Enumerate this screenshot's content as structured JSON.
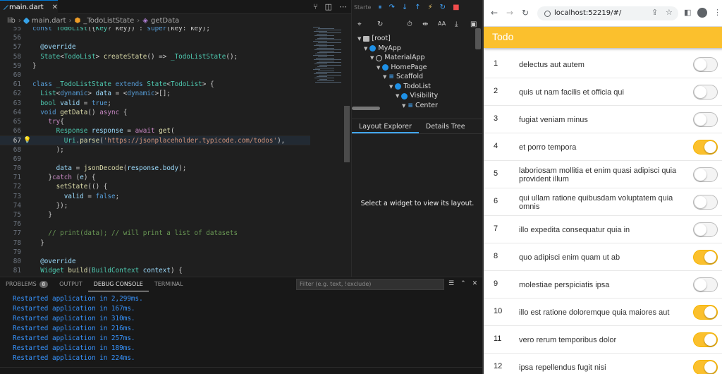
{
  "editor": {
    "tab_label": "main.dart",
    "breadcrumb": [
      "lib",
      "main.dart",
      "_TodoListState",
      "getData"
    ],
    "current_line": "66",
    "lines": [
      {
        "n": "55",
        "html": "<span class=\"kw\">const</span> <span class=\"ty\">TodoList</span>({<span class=\"ty\">Key</span>? key}) : <span class=\"kw\">super</span>(key: key);"
      },
      {
        "n": "56",
        "html": ""
      },
      {
        "n": "57",
        "html": "  <span class=\"an\">@override</span>"
      },
      {
        "n": "58",
        "html": "  <span class=\"ty\">State</span>&lt;<span class=\"ty\">TodoList</span>&gt; <span class=\"fn\">createState</span>() =&gt; <span class=\"ty\">_TodoListState</span>();"
      },
      {
        "n": "59",
        "html": "}"
      },
      {
        "n": "60",
        "html": ""
      },
      {
        "n": "61",
        "html": "<span class=\"kw\">class</span> <span class=\"ty\">_TodoListState</span> <span class=\"kw\">extends</span> <span class=\"ty\">State</span>&lt;<span class=\"ty\">TodoList</span>&gt; {"
      },
      {
        "n": "62",
        "html": "  <span class=\"ty\">List</span>&lt;<span class=\"kw\">dynamic</span>&gt; <span class=\"an\">data</span> = &lt;<span class=\"kw\">dynamic</span>&gt;[];"
      },
      {
        "n": "63",
        "html": "  <span class=\"ty\">bool</span> <span class=\"an\">valid</span> = <span class=\"kw\">true</span>;"
      },
      {
        "n": "64",
        "html": "  <span class=\"kw\">void</span> <span class=\"fn\">getData</span>() <span class=\"ctl\">async</span> {"
      },
      {
        "n": "65",
        "html": "    <span class=\"ctl\">try</span>{"
      },
      {
        "n": "66",
        "html": "      <span class=\"ty\">Response</span> <span class=\"an\">response</span> = <span class=\"ctl\">await</span> <span class=\"fn\">get</span>("
      },
      {
        "n": "66",
        "html": "        <span class=\"ty\">Uri</span>.<span class=\"fn\">parse</span>(<span class=\"str\">'https://jsonplaceholder.typicode.com/todos'</span>),"
      },
      {
        "n": "67",
        "html": "      );"
      },
      {
        "n": "68",
        "html": ""
      },
      {
        "n": "69",
        "html": "      <span class=\"an\">data</span> = <span class=\"fn\">jsonDecode</span>(<span class=\"an\">response</span>.<span class=\"an\">body</span>);"
      },
      {
        "n": "70",
        "html": "    }<span class=\"ctl\">catch</span> (<span class=\"an\">e</span>) {"
      },
      {
        "n": "71",
        "html": "      <span class=\"fn\">setState</span>(() {"
      },
      {
        "n": "72",
        "html": "        <span class=\"an\">valid</span> = <span class=\"kw\">false</span>;"
      },
      {
        "n": "73",
        "html": "      });"
      },
      {
        "n": "74",
        "html": "    }"
      },
      {
        "n": "75",
        "html": ""
      },
      {
        "n": "76",
        "html": "    <span class=\"cm\">// print(data); // will print a list of datasets</span>"
      },
      {
        "n": "77",
        "html": "  }"
      },
      {
        "n": "78",
        "html": ""
      },
      {
        "n": "79",
        "html": "  <span class=\"an\">@override</span>"
      },
      {
        "n": "80",
        "html": "  <span class=\"ty\">Widget</span> <span class=\"fn\">build</span>(<span class=\"ty\">BuildContext</span> <span class=\"an\">context</span>) {"
      }
    ]
  },
  "panel": {
    "tabs": [
      {
        "label": "PROBLEMS",
        "badge": "8"
      },
      {
        "label": "OUTPUT",
        "badge": ""
      },
      {
        "label": "DEBUG CONSOLE",
        "badge": ""
      },
      {
        "label": "TERMINAL",
        "badge": ""
      }
    ],
    "active_tab": "DEBUG CONSOLE",
    "filter_placeholder": "Filter (e.g. text, !exclude)",
    "console_lines": [
      "Restarted application in 2,299ms.",
      "Restarted application in 167ms.",
      "Restarted application in 310ms.",
      "Restarted application in 216ms.",
      "Restarted application in 257ms.",
      "Restarted application in 189ms.",
      "Restarted application in 224ms."
    ]
  },
  "devtools": {
    "top_label": "Starte",
    "tree": [
      {
        "label": "[root]",
        "depth": 0,
        "icon": "square"
      },
      {
        "label": "MyApp",
        "depth": 1,
        "icon": "dot"
      },
      {
        "label": "MaterialApp",
        "depth": 2,
        "icon": "material"
      },
      {
        "label": "HomePage",
        "depth": 3,
        "icon": "dot"
      },
      {
        "label": "Scaffold",
        "depth": 4,
        "icon": "bars"
      },
      {
        "label": "TodoList",
        "depth": 5,
        "icon": "dot"
      },
      {
        "label": "Visibility",
        "depth": 6,
        "icon": "dot"
      },
      {
        "label": "Center",
        "depth": 7,
        "icon": "bars"
      }
    ],
    "tabs": [
      "Layout Explorer",
      "Details Tree"
    ],
    "active_tab": "Layout Explorer",
    "empty_message": "Select a widget to view its layout."
  },
  "browser": {
    "url": "localhost:52219/#/",
    "app_title": "Todo",
    "accent": "#fbc02d",
    "todos": [
      {
        "id": "1",
        "title": "delectus aut autem",
        "completed": false
      },
      {
        "id": "2",
        "title": "quis ut nam facilis et officia qui",
        "completed": false
      },
      {
        "id": "3",
        "title": "fugiat veniam minus",
        "completed": false
      },
      {
        "id": "4",
        "title": "et porro tempora",
        "completed": true
      },
      {
        "id": "5",
        "title": "laboriosam mollitia et enim quasi adipisci quia provident illum",
        "completed": false
      },
      {
        "id": "6",
        "title": "qui ullam ratione quibusdam voluptatem quia omnis",
        "completed": false
      },
      {
        "id": "7",
        "title": "illo expedita consequatur quia in",
        "completed": false
      },
      {
        "id": "8",
        "title": "quo adipisci enim quam ut ab",
        "completed": true
      },
      {
        "id": "9",
        "title": "molestiae perspiciatis ipsa",
        "completed": false
      },
      {
        "id": "10",
        "title": "illo est ratione doloremque quia maiores aut",
        "completed": true
      },
      {
        "id": "11",
        "title": "vero rerum temporibus dolor",
        "completed": true
      },
      {
        "id": "12",
        "title": "ipsa repellendus fugit nisi",
        "completed": true
      }
    ]
  }
}
